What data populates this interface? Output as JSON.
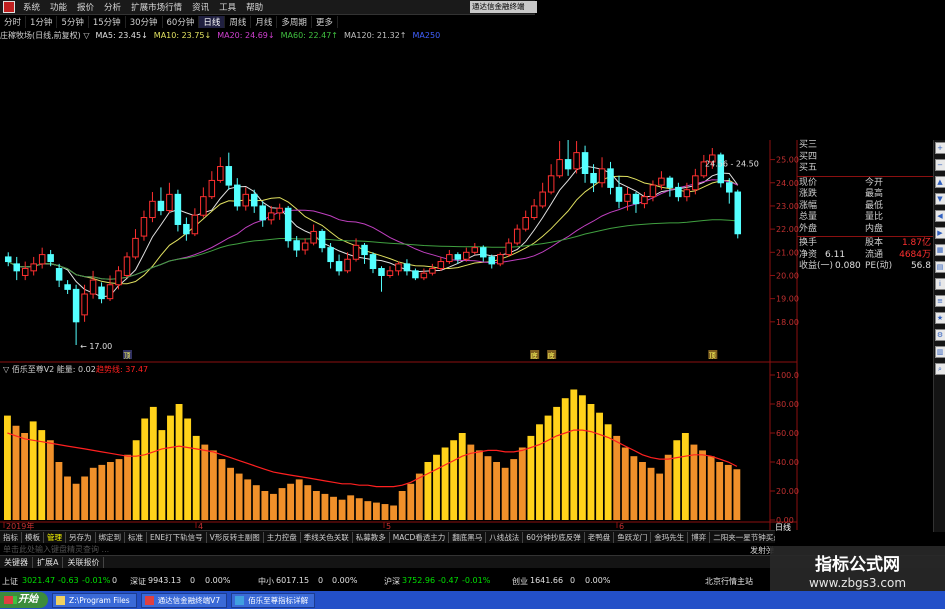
{
  "menu": {
    "items": [
      "系统",
      "功能",
      "报价",
      "分析",
      "扩展市场行情",
      "资讯",
      "工具",
      "帮助"
    ],
    "window_title": "通达信金融终端"
  },
  "period_bar": {
    "items": [
      "分时",
      "1分钟",
      "5分钟",
      "15分钟",
      "30分钟",
      "60分钟",
      "日线",
      "周线",
      "月线",
      "多周期",
      "更多"
    ],
    "active_index": 6
  },
  "main_indicator": {
    "title": "庄稼牧场(日线,前复权) ▽",
    "ma5": "MA5: 23.45↓",
    "ma10": "MA10: 23.75↓",
    "ma20": "MA20: 24.69↓",
    "ma60": "MA60: 22.47↑",
    "ma120": "MA120: 21.32↑",
    "extra": "MA250"
  },
  "price_axis": [
    "25.00",
    "24.00",
    "23.00",
    "22.00",
    "21.00",
    "20.00",
    "19.00",
    "18.00"
  ],
  "annotations": {
    "low_price": "17.00",
    "high_range": "24.56 - 24.50",
    "markers": [
      "顶",
      "底",
      "底",
      "顶"
    ]
  },
  "quote_panel": {
    "orders": [
      "买三",
      "买四",
      "买五"
    ],
    "rows": [
      {
        "l": "现价",
        "v1": "",
        "r": "今开",
        "v2": ""
      },
      {
        "l": "涨跌",
        "v1": "",
        "r": "最高",
        "v2": ""
      },
      {
        "l": "涨幅",
        "v1": "",
        "r": "最低",
        "v2": ""
      },
      {
        "l": "总量",
        "v1": "",
        "r": "量比",
        "v2": ""
      },
      {
        "l": "外盘",
        "v1": "",
        "r": "内盘",
        "v2": ""
      }
    ],
    "rows2": [
      {
        "l": "换手",
        "v1": "",
        "r": "股本",
        "v2": "1.87亿"
      },
      {
        "l": "净资",
        "v1": "6.11",
        "r": "流通",
        "v2": "4684万"
      },
      {
        "l": "收益(一)",
        "v1": "0.080",
        "r": "PE(动)",
        "v2": "56.8"
      }
    ]
  },
  "sub_indicator": {
    "title": "▽ 佰乐至尊V2",
    "param": "能量: 0.02",
    "line": "趋势线: 37.47",
    "axis": [
      "100.0",
      "80.00",
      "60.00",
      "40.00",
      "20.00",
      "0.00"
    ]
  },
  "date_axis": {
    "labels": [
      "2019年",
      "4",
      "5",
      "6"
    ],
    "period_flag": "日线"
  },
  "indicator_tabs": [
    "指标",
    "模板",
    "管理",
    "另存为",
    "绑定到",
    "标准",
    "ENE打下轨信号",
    "V形反转主副图",
    "主力控盘",
    "季线关色关联",
    "私募教多",
    "MACD看透主力",
    "翻底黑马",
    "八线战法",
    "60分钟抄底反弹",
    "老鸭盘",
    "鱼跃龙门",
    "金玛先生",
    "博弈",
    "二阳夹一星节钟买点",
    "海底捞金"
  ],
  "hint_text": "单击此处输入键盘精灵查询 ...",
  "send_text": "发射弹",
  "bottom_tabs": [
    "关键器",
    "扩展A",
    "关联报价"
  ],
  "ticker": {
    "sh_label": "上证",
    "sh": "3021.47",
    "sh_chg": "-0.63",
    "sh_pct": "-0.01%",
    "sh_tail": "0",
    "sz_label": "深证",
    "sz": "9943.13",
    "sz_val": "0",
    "sz_pct": "0.00%",
    "zx_label": "中小",
    "zx": "6017.15",
    "zx_val": "0",
    "zx_pct": "0.00%",
    "hs_label": "沪深",
    "hs": "3752.96",
    "hs_chg": "-0.47",
    "hs_pct": "-0.01%",
    "cy_label": "创业",
    "cy": "1641.66",
    "cy_val": "0",
    "cy_pct": "0.00%",
    "server": "北京行情主站"
  },
  "taskbar": {
    "start": "开始",
    "tasks": [
      "Z:\\Program Files",
      "通达信金融终端V7",
      "佰乐至尊指标详解"
    ]
  },
  "watermark": {
    "line1": "指标公式网",
    "line2": "www.zbgs3.com"
  },
  "colors": {
    "up": "#ff3030",
    "down_fill": "#54ffff",
    "volume_yellow": "#ffd21a",
    "volume_orange": "#f0902a",
    "trend_line": "#ff2020",
    "ma_white": "#e0e0e0",
    "ma_purple": "#c040c0",
    "ma_green": "#40a040"
  },
  "chart_data": {
    "type": "candlestick",
    "title": "庄稼牧场(日线,前复权)",
    "ylim": [
      17,
      25.5
    ],
    "candles": [
      [
        20.8,
        20.6,
        21.0,
        20.4
      ],
      [
        20.5,
        20.2,
        20.8,
        19.8
      ],
      [
        20.0,
        20.3,
        20.6,
        19.8
      ],
      [
        20.2,
        20.5,
        20.8,
        20.0
      ],
      [
        20.5,
        20.9,
        21.2,
        20.3
      ],
      [
        20.9,
        20.6,
        21.1,
        20.4
      ],
      [
        20.3,
        19.8,
        20.5,
        19.5
      ],
      [
        19.6,
        19.4,
        19.8,
        19.2
      ],
      [
        19.4,
        18.0,
        19.6,
        17.0
      ],
      [
        18.3,
        19.2,
        19.6,
        18.0
      ],
      [
        19.2,
        19.8,
        20.2,
        19.0
      ],
      [
        19.5,
        19.0,
        19.7,
        18.8
      ],
      [
        19.0,
        19.6,
        20.0,
        18.9
      ],
      [
        19.6,
        20.2,
        20.4,
        19.4
      ],
      [
        20.0,
        20.8,
        21.0,
        19.9
      ],
      [
        20.8,
        21.6,
        22.0,
        20.7
      ],
      [
        21.7,
        22.5,
        22.8,
        21.5
      ],
      [
        22.5,
        23.2,
        23.6,
        22.3
      ],
      [
        23.2,
        22.8,
        23.8,
        22.6
      ],
      [
        22.8,
        23.5,
        24.0,
        22.7
      ],
      [
        23.5,
        22.2,
        23.7,
        21.9
      ],
      [
        22.2,
        21.8,
        22.5,
        21.5
      ],
      [
        21.8,
        22.6,
        22.9,
        21.7
      ],
      [
        22.6,
        23.4,
        23.8,
        22.5
      ],
      [
        23.4,
        24.1,
        24.5,
        23.3
      ],
      [
        24.1,
        24.7,
        25.1,
        24.0
      ],
      [
        24.7,
        23.9,
        25.3,
        23.7
      ],
      [
        23.9,
        23.0,
        24.2,
        22.8
      ],
      [
        23.0,
        23.5,
        23.8,
        22.8
      ],
      [
        23.5,
        23.0,
        23.7,
        22.7
      ],
      [
        23.0,
        22.4,
        23.2,
        22.1
      ],
      [
        22.4,
        22.7,
        23.0,
        22.2
      ],
      [
        22.7,
        22.9,
        23.1,
        22.4
      ],
      [
        22.9,
        21.5,
        23.0,
        21.2
      ],
      [
        21.5,
        21.1,
        21.7,
        20.8
      ],
      [
        21.1,
        21.4,
        21.6,
        20.9
      ],
      [
        21.4,
        21.9,
        22.2,
        21.3
      ],
      [
        21.9,
        21.2,
        22.0,
        21.0
      ],
      [
        21.2,
        20.6,
        21.4,
        20.3
      ],
      [
        20.6,
        20.2,
        20.9,
        20.0
      ],
      [
        20.2,
        20.7,
        21.0,
        20.1
      ],
      [
        20.7,
        21.3,
        21.6,
        20.6
      ],
      [
        21.3,
        20.9,
        21.4,
        20.5
      ],
      [
        20.9,
        20.3,
        21.0,
        20.1
      ],
      [
        20.3,
        20.0,
        20.4,
        19.3
      ],
      [
        20.0,
        20.2,
        20.4,
        19.9
      ],
      [
        20.2,
        20.5,
        20.6,
        20.0
      ],
      [
        20.5,
        20.2,
        20.7,
        20.0
      ],
      [
        20.2,
        19.9,
        20.3,
        19.8
      ],
      [
        19.9,
        20.1,
        20.3,
        19.8
      ],
      [
        20.1,
        20.3,
        20.5,
        20.0
      ],
      [
        20.3,
        20.6,
        20.8,
        20.2
      ],
      [
        20.6,
        20.9,
        21.1,
        20.5
      ],
      [
        20.9,
        20.7,
        21.0,
        20.5
      ],
      [
        20.7,
        21.0,
        21.2,
        20.6
      ],
      [
        21.0,
        21.2,
        21.4,
        20.9
      ],
      [
        21.2,
        20.8,
        21.3,
        20.6
      ],
      [
        20.8,
        20.5,
        20.9,
        20.3
      ],
      [
        20.5,
        20.9,
        21.0,
        20.4
      ],
      [
        20.9,
        21.4,
        21.6,
        20.8
      ],
      [
        21.4,
        22.0,
        22.2,
        21.3
      ],
      [
        22.0,
        22.5,
        22.8,
        21.9
      ],
      [
        22.5,
        23.0,
        23.3,
        22.4
      ],
      [
        23.0,
        23.6,
        24.0,
        22.9
      ],
      [
        23.6,
        24.3,
        24.8,
        23.5
      ],
      [
        24.3,
        25.0,
        25.8,
        24.2
      ],
      [
        25.0,
        24.6,
        25.9,
        24.3
      ],
      [
        24.6,
        25.3,
        25.8,
        24.4
      ],
      [
        25.3,
        24.4,
        25.6,
        24.0
      ],
      [
        24.4,
        24.0,
        24.8,
        23.6
      ],
      [
        24.0,
        24.6,
        25.1,
        23.8
      ],
      [
        24.6,
        23.8,
        24.9,
        23.5
      ],
      [
        23.8,
        23.2,
        24.3,
        22.9
      ],
      [
        23.2,
        23.5,
        23.8,
        22.8
      ],
      [
        23.5,
        23.1,
        23.6,
        22.7
      ],
      [
        23.1,
        23.4,
        23.6,
        22.9
      ],
      [
        23.4,
        23.9,
        24.1,
        23.2
      ],
      [
        23.9,
        24.2,
        24.5,
        23.7
      ],
      [
        24.2,
        23.8,
        24.3,
        23.4
      ],
      [
        23.8,
        23.4,
        24.0,
        23.2
      ],
      [
        23.4,
        23.7,
        24.0,
        23.2
      ],
      [
        23.7,
        24.3,
        24.6,
        23.5
      ],
      [
        24.3,
        24.9,
        25.2,
        24.2
      ],
      [
        24.9,
        25.2,
        25.5,
        24.6
      ],
      [
        25.2,
        24.0,
        25.3,
        23.8
      ],
      [
        24.0,
        23.6,
        24.2,
        23.1
      ],
      [
        23.6,
        21.8,
        23.7,
        21.6
      ]
    ],
    "volume_bars": [
      72,
      65,
      60,
      68,
      62,
      55,
      40,
      30,
      25,
      30,
      36,
      38,
      40,
      42,
      45,
      55,
      70,
      78,
      62,
      72,
      80,
      70,
      58,
      52,
      48,
      42,
      36,
      32,
      28,
      24,
      20,
      18,
      22,
      25,
      28,
      24,
      20,
      18,
      16,
      14,
      17,
      15,
      13,
      12,
      11,
      10,
      20,
      25,
      32,
      40,
      45,
      50,
      55,
      60,
      52,
      48,
      44,
      40,
      36,
      42,
      50,
      58,
      66,
      72,
      78,
      84,
      90,
      86,
      80,
      74,
      66,
      58,
      50,
      44,
      40,
      36,
      32,
      45,
      55,
      60,
      52,
      48,
      44,
      40,
      38,
      35
    ],
    "trend_line": [
      60,
      58,
      56,
      55,
      54,
      53,
      52,
      51,
      50,
      49,
      48,
      47,
      46,
      45,
      44,
      44,
      45,
      47,
      49,
      50,
      51,
      50,
      49,
      48,
      47,
      45,
      43,
      41,
      39,
      37,
      35,
      33,
      32,
      31,
      30,
      29,
      28,
      27,
      26,
      25,
      25,
      24,
      24,
      23,
      23,
      23,
      24,
      26,
      29,
      32,
      35,
      38,
      41,
      44,
      46,
      47,
      48,
      48,
      47,
      47,
      48,
      50,
      52,
      55,
      58,
      60,
      62,
      62,
      61,
      59,
      57,
      54,
      51,
      48,
      45,
      43,
      42,
      42,
      43,
      44,
      45,
      45,
      44,
      42,
      40,
      37
    ]
  }
}
